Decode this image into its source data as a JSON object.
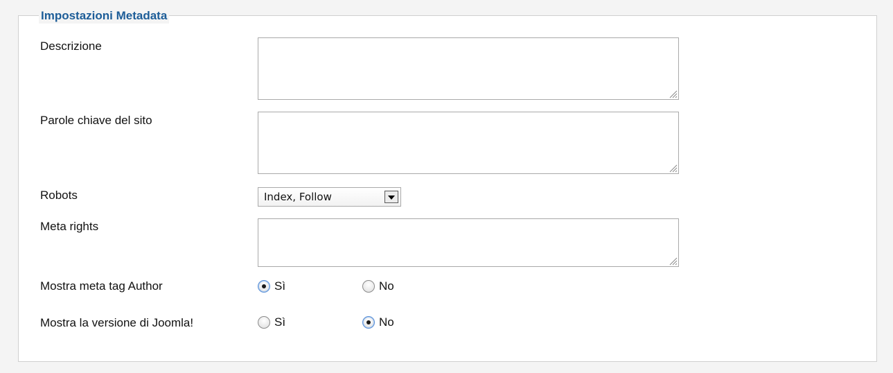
{
  "fieldset": {
    "legend": "Impostazioni Metadata"
  },
  "fields": {
    "description": {
      "label": "Descrizione",
      "value": ""
    },
    "keywords": {
      "label": "Parole chiave del sito",
      "value": ""
    },
    "robots": {
      "label": "Robots",
      "selected": "Index, Follow"
    },
    "rights": {
      "label": "Meta rights",
      "value": ""
    },
    "author": {
      "label": "Mostra meta tag Author",
      "options": [
        "Sì",
        "No"
      ],
      "selected": "Sì"
    },
    "joomla_version": {
      "label": "Mostra la versione di Joomla!",
      "options": [
        "Sì",
        "No"
      ],
      "selected": "No"
    }
  }
}
